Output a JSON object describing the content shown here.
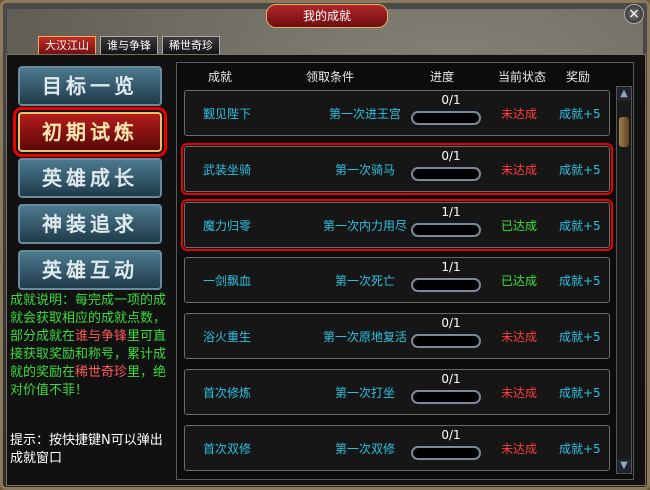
{
  "window": {
    "title": "我的成就",
    "close_icon": "×"
  },
  "tabs": [
    {
      "label": "大汉江山",
      "active": true
    },
    {
      "label": "谁与争锋",
      "active": false
    },
    {
      "label": "稀世奇珍",
      "active": false
    }
  ],
  "nav": [
    {
      "label": "目标一览",
      "active": false
    },
    {
      "label": "初期试炼",
      "active": true
    },
    {
      "label": "英雄成长",
      "active": false
    },
    {
      "label": "神装追求",
      "active": false
    },
    {
      "label": "英雄互动",
      "active": false
    }
  ],
  "description": {
    "p1": "成就说明：每完成一项的成就会获取相应的成就点数，部分成就在",
    "h1": "谁与争锋",
    "p2": "里可直接获取奖励和称号，累计成就的奖励在",
    "h2": "稀世奇珍",
    "p3": "里，绝对价值不菲！"
  },
  "tip": "提示：按快捷键N可以弹出成就窗口",
  "table": {
    "headers": [
      "成就",
      "领取条件",
      "进度",
      "当前状态",
      "奖励"
    ],
    "rows": [
      {
        "name": "觐见陛下",
        "cond": "第一次进王宫",
        "progress": "0/1",
        "fill": 0,
        "status": "未达成",
        "done": false,
        "reward": "成就+5"
      },
      {
        "name": "武装坐骑",
        "cond": "第一次骑马",
        "progress": "0/1",
        "fill": 0,
        "status": "未达成",
        "done": false,
        "reward": "成就+5"
      },
      {
        "name": "魔力归零",
        "cond": "第一次内力用尽",
        "progress": "1/1",
        "fill": 1,
        "status": "已达成",
        "done": true,
        "reward": "成就+5"
      },
      {
        "name": "一剑飘血",
        "cond": "第一次死亡",
        "progress": "1/1",
        "fill": 1,
        "status": "已达成",
        "done": true,
        "reward": "成就+5"
      },
      {
        "name": "浴火重生",
        "cond": "第一次原地复活",
        "progress": "0/1",
        "fill": 0,
        "status": "未达成",
        "done": false,
        "reward": "成就+5"
      },
      {
        "name": "首次修炼",
        "cond": "第一次打坐",
        "progress": "0/1",
        "fill": 0,
        "status": "未达成",
        "done": false,
        "reward": "成就+5"
      },
      {
        "name": "首次双修",
        "cond": "第一次双修",
        "progress": "0/1",
        "fill": 0,
        "status": "未达成",
        "done": false,
        "reward": "成就+5"
      }
    ]
  },
  "scroll": {
    "up_icon": "▲",
    "down_icon": "▼"
  }
}
